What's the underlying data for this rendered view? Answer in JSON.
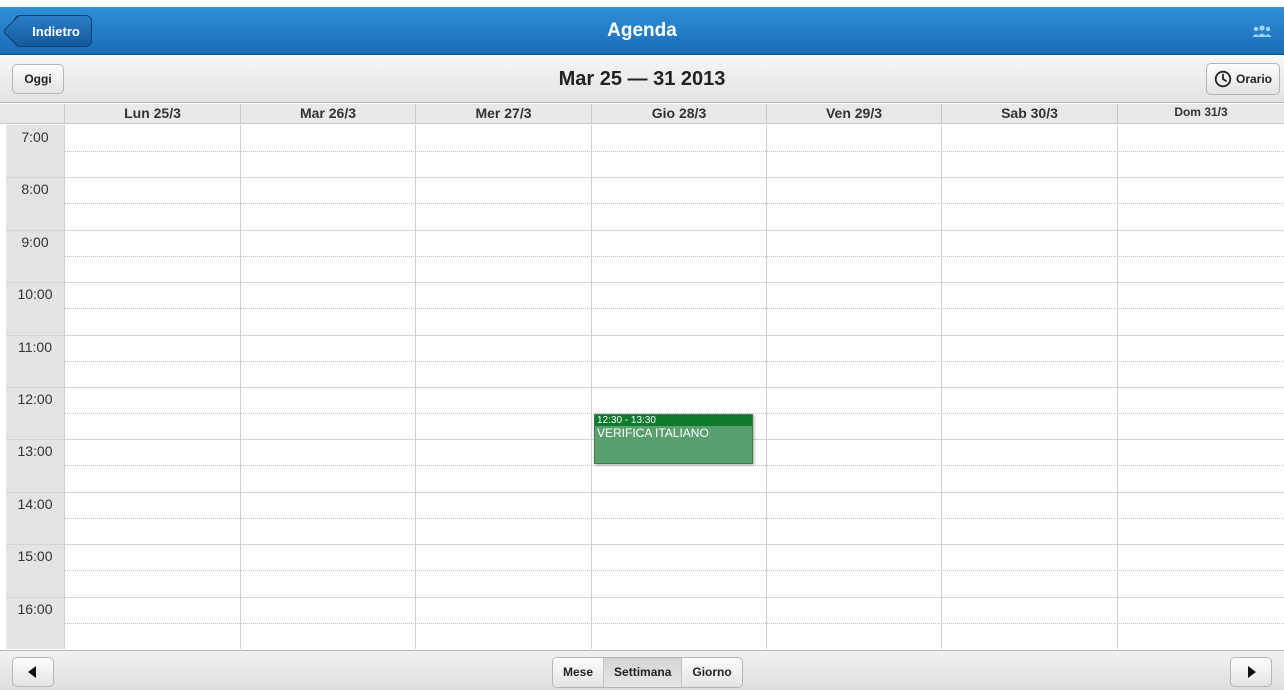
{
  "header": {
    "back_label": "Indietro",
    "title": "Agenda",
    "users_icon": "users-icon"
  },
  "toolbar": {
    "today_label": "Oggi",
    "week_title": "Mar 25 — 31 2013",
    "schedule_label": "Orario",
    "schedule_icon": "clock-icon"
  },
  "days": [
    "Lun 25/3",
    "Mar 26/3",
    "Mer 27/3",
    "Gio 28/3",
    "Ven 29/3",
    "Sab 30/3",
    "Dom 31/3"
  ],
  "hours": [
    "7:00",
    "8:00",
    "9:00",
    "10:00",
    "11:00",
    "12:00",
    "13:00",
    "14:00",
    "15:00",
    "16:00"
  ],
  "event": {
    "time": "12:30 - 13:30",
    "title": "VERIFICA ITALIANO",
    "day": "Gio 28/3",
    "color": "#5aa06e",
    "header_color": "#0e7a2e"
  },
  "footer": {
    "prev_icon": "left-arrow-icon",
    "next_icon": "right-arrow-icon",
    "views": [
      "Mese",
      "Settimana",
      "Giorno"
    ],
    "active_view": "Settimana"
  },
  "colors": {
    "header_blue": "#1a6db5",
    "event_green": "#5aa06e"
  }
}
